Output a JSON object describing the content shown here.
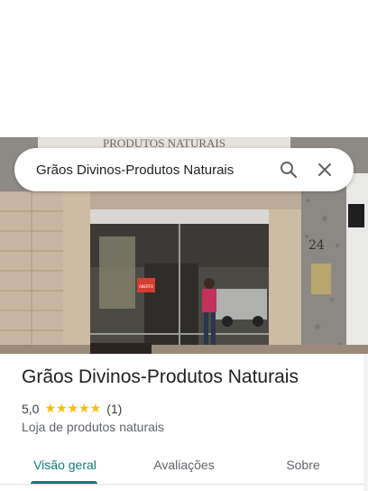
{
  "search": {
    "query": "Grãos Divinos-Produtos Naturais"
  },
  "icons": {
    "search": "search-icon",
    "close": "close-icon",
    "star": "star-icon"
  },
  "place": {
    "name": "Grãos Divinos-Produtos Naturais",
    "rating": "5,0",
    "stars": "★★★★★",
    "review_count": "(1)",
    "category": "Loja de produtos naturais",
    "storefront_sign": "PRODUTOS NATURAIS",
    "door_sign": "ABERTO"
  },
  "tabs": [
    {
      "label": "Visão geral",
      "active": true
    },
    {
      "label": "Avaliações",
      "active": false
    },
    {
      "label": "Sobre",
      "active": false
    }
  ],
  "colors": {
    "accent": "#0d7c79",
    "star": "#fbbc04",
    "text_primary": "#202124",
    "text_secondary": "#5f6368"
  }
}
